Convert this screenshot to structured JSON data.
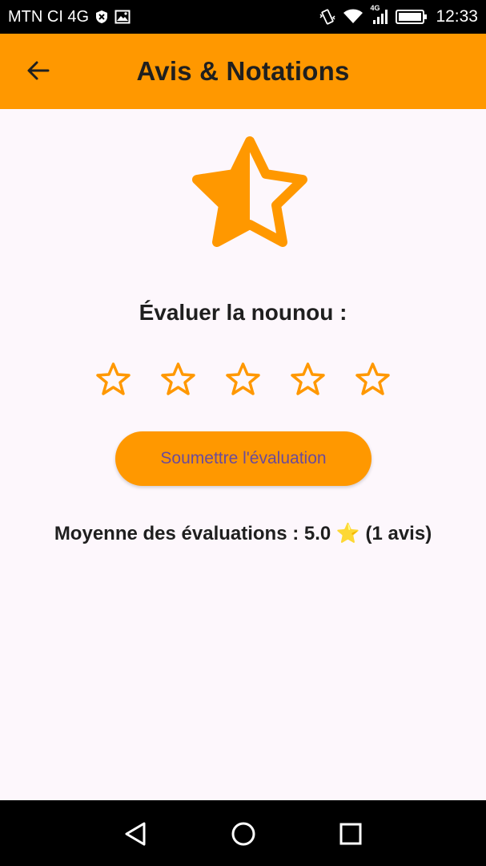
{
  "status_bar": {
    "carrier": "MTN CI 4G",
    "network_badge": "4G",
    "time": "12:33",
    "icons": [
      "shield-x-icon",
      "image-icon",
      "vibrate-icon",
      "wifi-icon",
      "signal-icon",
      "battery-icon"
    ]
  },
  "app_bar": {
    "title": "Avis & Notations",
    "back_icon": "arrow-left-icon",
    "background": "#FF9800"
  },
  "main": {
    "hero_icon": "star-half-icon",
    "rate_label": "Évaluer la nounou :",
    "rating": {
      "max": 5,
      "selected": 0
    },
    "submit_label": "Soumettre l'évaluation",
    "average_text": "Moyenne des évaluations : 5.0 ⭐ (1 avis)"
  },
  "nav_bar": {
    "icons": [
      "back-triangle-icon",
      "home-circle-icon",
      "recent-square-icon"
    ]
  },
  "colors": {
    "accent": "#FF9800",
    "button_text": "#6A4B9A",
    "background": "#FDF7FC"
  }
}
